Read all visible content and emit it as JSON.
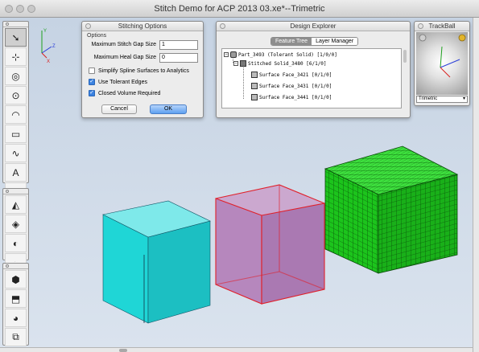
{
  "window": {
    "title": "Stitch Demo for ACP 2013 03.xe*--Trimetric"
  },
  "toolbar": {
    "group1": [
      {
        "icon": "select-arrow-icon",
        "glyph": "➘"
      },
      {
        "icon": "point-icon",
        "glyph": "⊹"
      },
      {
        "icon": "spiral-icon",
        "glyph": "◎"
      },
      {
        "icon": "circle-icon",
        "glyph": "⊙"
      },
      {
        "icon": "arc-icon",
        "glyph": "◠"
      },
      {
        "icon": "rectangle-icon",
        "glyph": "▭"
      },
      {
        "icon": "spline-icon",
        "glyph": "∿"
      },
      {
        "icon": "text-icon",
        "glyph": "A"
      },
      {
        "icon": "dimension-icon",
        "glyph": "⊢"
      },
      {
        "icon": "fillet-icon",
        "glyph": "⌒"
      },
      {
        "icon": "trim-icon",
        "glyph": "✂"
      },
      {
        "icon": "offset-icon",
        "glyph": "⎍"
      },
      {
        "icon": "sketch-edit-icon",
        "glyph": "✎"
      }
    ],
    "group2": [
      {
        "icon": "surface-icon",
        "glyph": "◭"
      },
      {
        "icon": "loft-icon",
        "glyph": "◈"
      },
      {
        "icon": "sweep-icon",
        "glyph": "◐"
      },
      {
        "icon": "blend-icon",
        "glyph": "◒"
      },
      {
        "icon": "knit-icon",
        "glyph": "▧"
      }
    ],
    "group3": [
      {
        "icon": "solid-icon",
        "glyph": "⬢"
      },
      {
        "icon": "extrude-icon",
        "glyph": "⬒"
      },
      {
        "icon": "revolve-icon",
        "glyph": "◕"
      },
      {
        "icon": "boolean-icon",
        "glyph": "⧉"
      },
      {
        "icon": "shell-icon",
        "glyph": "⬚"
      }
    ]
  },
  "stitching": {
    "title": "Stitching Options",
    "section_label": "Options",
    "max_stitch_gap_label": "Maximum Stitch Gap Size",
    "max_stitch_gap_value": "1",
    "max_heal_gap_label": "Maximum Heal Gap Size",
    "max_heal_gap_value": "0",
    "simplify_label": "Simplify Spline Surfaces to Analytics",
    "simplify_checked": false,
    "tolerant_label": "Use Tolerant Edges",
    "tolerant_checked": true,
    "closed_label": "Closed Volume Required",
    "closed_checked": true,
    "cancel_label": "Cancel",
    "ok_label": "OK"
  },
  "explorer": {
    "title": "Design Explorer",
    "tabs": [
      "Feature Tree",
      "Layer Manager"
    ],
    "active_tab": 0,
    "tree": [
      {
        "label": "Part_3493 (Tolerant Solid) [1/0/0]",
        "expander": "−"
      },
      {
        "label": "Stitched Solid_3480 [6/1/0]",
        "expander": "−"
      },
      {
        "label": "Surface Face_3421 [0/1/0]",
        "expander": ""
      },
      {
        "label": "Surface Face_3431 [0/1/0]",
        "expander": ""
      },
      {
        "label": "Surface Face_3441 [0/1/0]",
        "expander": ""
      }
    ]
  },
  "trackball": {
    "title": "TrackBall",
    "view_option": "Trimetric"
  },
  "axes": {
    "x_label": "X",
    "y_label": "Y",
    "z_label": "Z"
  },
  "colors": {
    "cyan_box": "#1ed8d8",
    "purple_box": "#b07fb4",
    "purple_edge": "#e0202a",
    "green_box": "#1ec81e",
    "axis_red": "#d8201e",
    "axis_green": "#1ea01e",
    "axis_blue": "#2a3ed8"
  }
}
